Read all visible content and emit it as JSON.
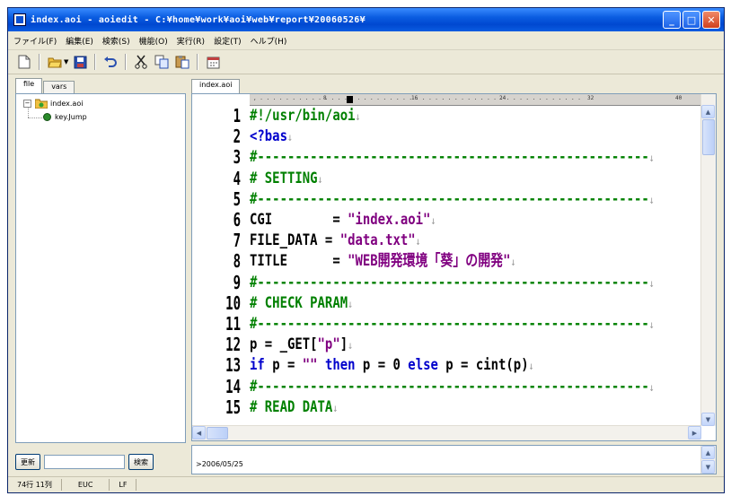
{
  "window": {
    "title": "index.aoi - aoiedit - C:¥home¥work¥aoi¥web¥report¥20060526¥"
  },
  "menu": [
    "ファイル(F)",
    "編集(E)",
    "検索(S)",
    "機能(O)",
    "実行(R)",
    "設定(T)",
    "ヘルプ(H)"
  ],
  "toolbar": {
    "buttons": [
      "new-file-icon",
      "open-folder-icon",
      "save-icon",
      "undo-icon",
      "cut-icon",
      "copy-icon",
      "paste-icon",
      "calendar-icon"
    ]
  },
  "left_panel": {
    "tabs": [
      "file",
      "vars"
    ],
    "tree": {
      "root": "index.aoi",
      "child": "key.Jump"
    },
    "refresh_label": "更新",
    "search_label": "検索",
    "search_value": ""
  },
  "editor": {
    "tab": "index.aoi",
    "ruler_marks": [
      "8",
      "16",
      "24",
      "32",
      "40"
    ],
    "lines": [
      {
        "n": "1",
        "segments": [
          {
            "t": "#!/usr/bin/aoi",
            "c": "c-comment"
          }
        ]
      },
      {
        "n": "2",
        "segments": [
          {
            "t": "<?bas",
            "c": "c-keyword"
          }
        ]
      },
      {
        "n": "3",
        "segments": [
          {
            "t": "#----------------------------------------------------",
            "c": "c-comment"
          }
        ]
      },
      {
        "n": "4",
        "segments": [
          {
            "t": "# SETTING",
            "c": "c-comment"
          }
        ]
      },
      {
        "n": "5",
        "segments": [
          {
            "t": "#----------------------------------------------------",
            "c": "c-comment"
          }
        ]
      },
      {
        "n": "6",
        "segments": [
          {
            "t": "CGI        = ",
            "c": "c-text"
          },
          {
            "t": "\"index.aoi\"",
            "c": "c-string"
          }
        ]
      },
      {
        "n": "7",
        "segments": [
          {
            "t": "FILE_DATA = ",
            "c": "c-text"
          },
          {
            "t": "\"data.txt\"",
            "c": "c-string"
          }
        ]
      },
      {
        "n": "8",
        "segments": [
          {
            "t": "TITLE      = ",
            "c": "c-text"
          },
          {
            "t": "\"WEB開発環境「葵」の開発\"",
            "c": "c-string"
          }
        ]
      },
      {
        "n": "9",
        "segments": [
          {
            "t": "#----------------------------------------------------",
            "c": "c-comment"
          }
        ]
      },
      {
        "n": "10",
        "segments": [
          {
            "t": "# CHECK PARAM",
            "c": "c-comment"
          }
        ]
      },
      {
        "n": "11",
        "segments": [
          {
            "t": "#----------------------------------------------------",
            "c": "c-comment"
          }
        ]
      },
      {
        "n": "12",
        "segments": [
          {
            "t": "p = _GET[",
            "c": "c-text"
          },
          {
            "t": "\"p\"",
            "c": "c-string"
          },
          {
            "t": "]",
            "c": "c-text"
          }
        ]
      },
      {
        "n": "13",
        "segments": [
          {
            "t": "if ",
            "c": "c-keyword"
          },
          {
            "t": "p = ",
            "c": "c-text"
          },
          {
            "t": "\"\" ",
            "c": "c-string"
          },
          {
            "t": "then ",
            "c": "c-keyword"
          },
          {
            "t": "p = 0 ",
            "c": "c-text"
          },
          {
            "t": "else ",
            "c": "c-keyword"
          },
          {
            "t": "p = cint(p)",
            "c": "c-text"
          }
        ]
      },
      {
        "n": "14",
        "segments": [
          {
            "t": "#----------------------------------------------------",
            "c": "c-comment"
          }
        ]
      },
      {
        "n": "15",
        "segments": [
          {
            "t": "# READ DATA",
            "c": "c-comment"
          }
        ]
      }
    ]
  },
  "output": {
    "text": ">2006/05/25"
  },
  "status": {
    "position": "74行 11列",
    "encoding": "EUC",
    "line_ending": "LF"
  },
  "colors": {
    "comment": "#008000",
    "keyword": "#0000cc",
    "string": "#800080",
    "titlebar": "#0a5ce0"
  }
}
